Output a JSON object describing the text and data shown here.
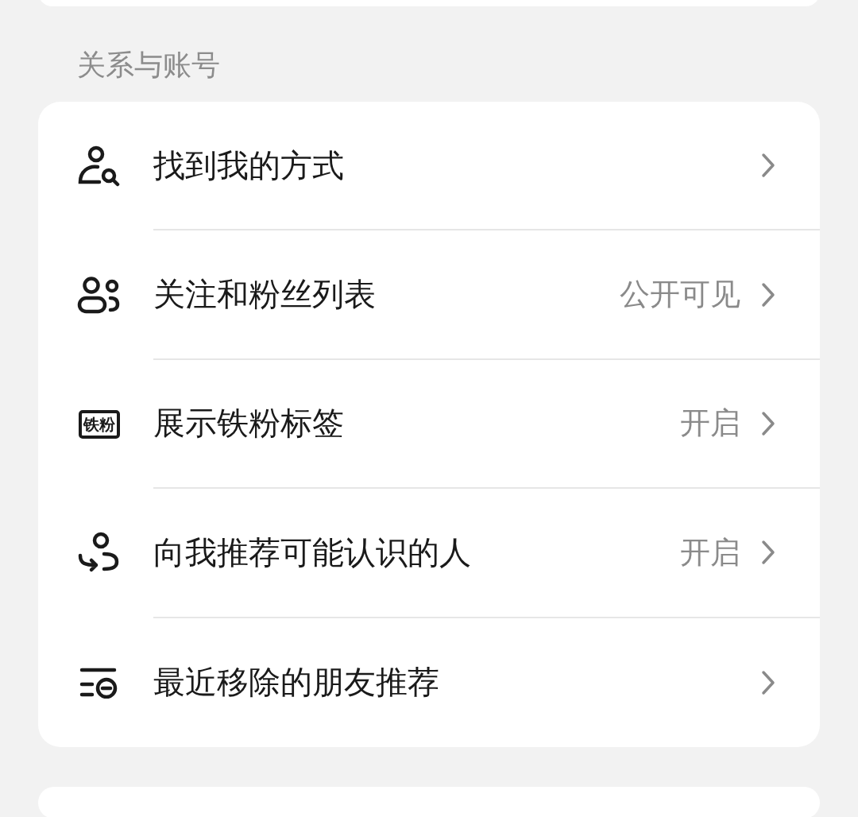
{
  "section_title": "关系与账号",
  "items": [
    {
      "kind": "person-search",
      "label": "找到我的方式"
    },
    {
      "kind": "people",
      "label": "关注和粉丝列表",
      "value": "公开可见"
    },
    {
      "kind": "badge",
      "badge_text": "铁粉",
      "label": "展示铁粉标签",
      "value": "开启"
    },
    {
      "kind": "person-arrow",
      "label": "向我推荐可能认识的人",
      "value": "开启"
    },
    {
      "kind": "list",
      "label": "最近移除的朋友推荐"
    }
  ]
}
